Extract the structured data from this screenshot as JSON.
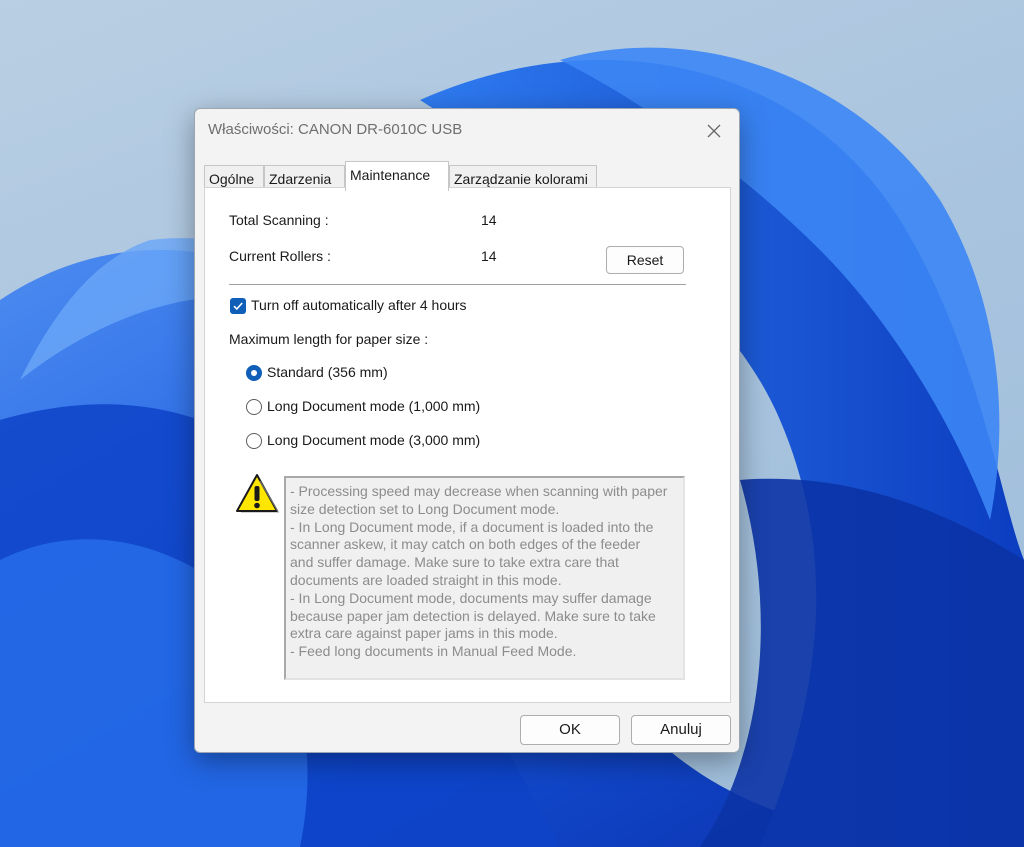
{
  "window": {
    "title": "Właściwości: CANON DR-6010C USB"
  },
  "tabs": [
    {
      "label": "Ogólne"
    },
    {
      "label": "Zdarzenia"
    },
    {
      "label": "Maintenance",
      "active": true
    },
    {
      "label": "Zarządzanie kolorami"
    }
  ],
  "counters": {
    "total_scanning_label": "Total Scanning :",
    "total_scanning_value": "14",
    "current_rollers_label": "Current Rollers :",
    "current_rollers_value": "14",
    "reset_label": "Reset"
  },
  "auto_off": {
    "label": "Turn off automatically after 4 hours",
    "checked": true
  },
  "paper_size": {
    "heading": "Maximum length for paper size :",
    "options": [
      {
        "label": "Standard (356 mm)",
        "selected": true
      },
      {
        "label": "Long Document mode (1,000 mm)",
        "selected": false
      },
      {
        "label": "Long Document mode (3,000 mm)",
        "selected": false
      }
    ]
  },
  "warning": {
    "icon": "warning-icon",
    "lines": [
      "- Processing speed may decrease when scanning with paper",
      "size detection set to Long Document mode.",
      "- In Long Document mode, if a document is loaded into the",
      "scanner askew, it may catch on both edges of the feeder",
      "and suffer damage. Make sure to take extra care that",
      "documents are loaded straight in this mode.",
      "- In Long Document mode, documents may suffer damage",
      "because paper jam detection is delayed. Make sure to take",
      "extra care against paper jams in this mode.",
      "- Feed long documents in Manual Feed Mode."
    ]
  },
  "buttons": {
    "ok": "OK",
    "cancel": "Anuluj"
  },
  "colors": {
    "accent": "#0f5fb8",
    "wallpaper": "#1a5fe0",
    "warning": "#ffe600"
  }
}
